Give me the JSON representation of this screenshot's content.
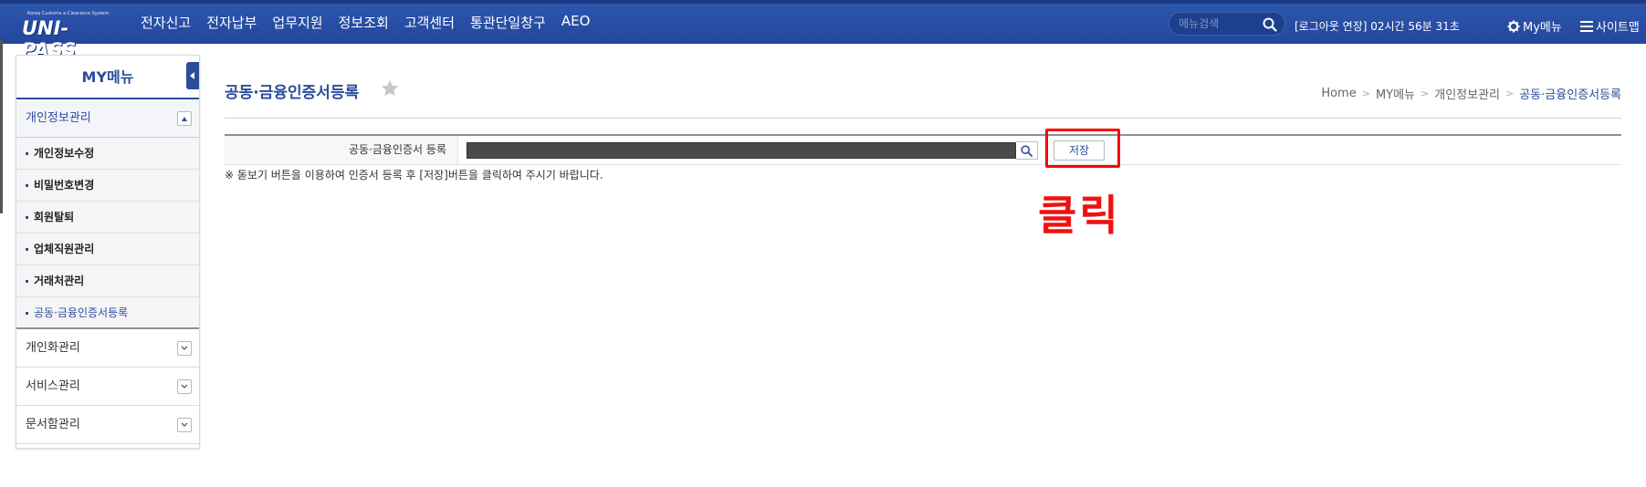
{
  "header": {
    "logo_tagline": "Korea Customs e-Clearance System",
    "logo_text": "UNI-PASS",
    "nav_items": [
      "전자신고",
      "전자납부",
      "업무지원",
      "정보조회",
      "고객센터",
      "통관단일창구",
      "AEO"
    ],
    "search_placeholder": "메뉴검색",
    "session_text": "[로그아웃 연장] 02시간 56분 31초",
    "mymenu_label": "My메뉴",
    "sitemap_label": "사이트맵"
  },
  "sidebar": {
    "title": "MY메뉴",
    "groups": [
      {
        "label": "개인정보관리",
        "expanded": true,
        "items": [
          "개인정보수정",
          "비밀번호변경",
          "회원탈퇴",
          "업체직원관리",
          "거래처관리",
          "공동·금융인증서등록"
        ],
        "active_item": "공동·금융인증서등록"
      },
      {
        "label": "개인화관리",
        "expanded": false
      },
      {
        "label": "서비스관리",
        "expanded": false
      },
      {
        "label": "문서함관리",
        "expanded": false
      }
    ]
  },
  "main": {
    "page_title": "공동·금융인증서등록",
    "breadcrumb": [
      "Home",
      "MY메뉴",
      "개인정보관리",
      "공동·금융인증서등록"
    ],
    "form": {
      "label": "공동·금융인증서 등록",
      "cert_value": "",
      "save_label": "저장"
    },
    "notice": "※ 돋보기 버튼을 이용하여 인증서 등록 후 [저장]버튼을 클릭하여 주시기 바랍니다."
  },
  "annotation": {
    "text": "클릭",
    "color": "#ee1111"
  },
  "colors": {
    "header_bg": "#2a52a8",
    "accent": "#2c4d9a"
  }
}
